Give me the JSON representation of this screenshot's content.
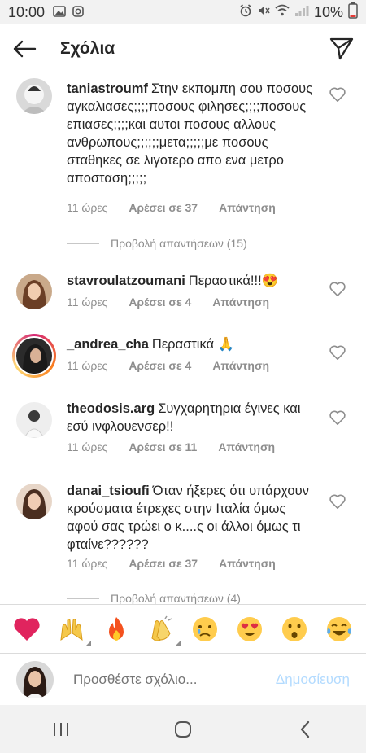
{
  "status_bar": {
    "time": "10:00",
    "battery": "10%"
  },
  "header": {
    "title": "Σχόλια"
  },
  "comments": [
    {
      "username": "taniastroumf",
      "text": "Στην εκπομπη σου ποσους αγκαλιασες;;;;ποσους φιλησες;;;;ποσους επιασες;;;;και αυτοι ποσους αλλους ανθρωπους;;;;;;μετα;;;;;με ποσους σταθηκες σε λιγοτερο απο ενα μετρο αποσταση;;;;;",
      "time": "11 ώρες",
      "likes": "Αρέσει σε 37",
      "reply": "Απάντηση",
      "view_replies": "Προβολή απαντήσεων (15)"
    },
    {
      "username": "stavroulatzoumani",
      "text": "Περαστικά!!!😍",
      "time": "11 ώρες",
      "likes": "Αρέσει σε 4",
      "reply": "Απάντηση"
    },
    {
      "username": "_andrea_cha",
      "text": "Περαστικά 🙏",
      "time": "11 ώρες",
      "likes": "Αρέσει σε 4",
      "reply": "Απάντηση"
    },
    {
      "username": "theodosis.arg",
      "text": "Συγχαρητηρια έγινες και εσύ ινφλουενσερ!!",
      "time": "11 ώρες",
      "likes": "Αρέσει σε 11",
      "reply": "Απάντηση"
    },
    {
      "username": "danai_tsioufi",
      "text": "Όταν ήξερες ότι υπάρχουν κρούσματα έτρεχες στην Ιταλία όμως αφού σας τρώει ο κ....ς οι άλλοι όμως τι φταίνε??????",
      "time": "11 ώρες",
      "likes": "Αρέσει σε 37",
      "reply": "Απάντηση",
      "view_replies": "Προβολή απαντήσεων (4)"
    }
  ],
  "emoji_bar": [
    "❤️",
    "🙌",
    "🔥",
    "👏",
    "😢",
    "😍",
    "😮",
    "😂"
  ],
  "compose": {
    "placeholder": "Προσθέστε σχόλιο...",
    "post_label": "Δημοσίευση"
  }
}
